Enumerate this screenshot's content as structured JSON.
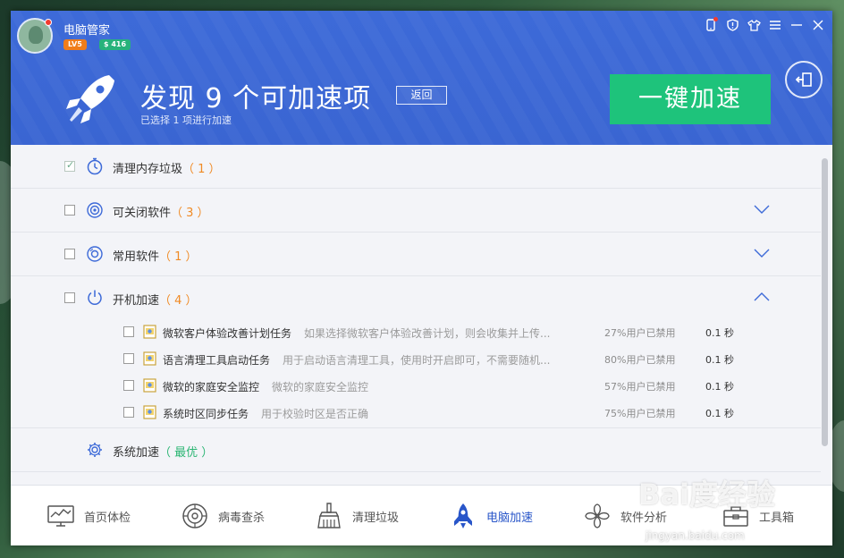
{
  "app": {
    "title": "电脑管家",
    "level": "LV5",
    "coins": "$ 416"
  },
  "header": {
    "headline": "发现 9 个可加速项",
    "back_label": "返回",
    "subline": "已选择 1 项进行加速",
    "accelerate_label": "一键加速"
  },
  "categories": [
    {
      "label": "清理内存垃圾",
      "count": "（ 1 ）",
      "checked": true,
      "icon": "stopwatch-icon"
    },
    {
      "label": "可关闭软件",
      "count": "（ 3 ）",
      "checked": false,
      "icon": "target-icon"
    },
    {
      "label": "常用软件",
      "count": "（ 1 ）",
      "checked": false,
      "icon": "disc-icon"
    },
    {
      "label": "开机加速",
      "count": "（ 4 ）",
      "checked": false,
      "icon": "power-icon"
    },
    {
      "label": "系统加速",
      "count": "（ 最优 ）",
      "icon": "gear-icon"
    }
  ],
  "startup_items": [
    {
      "name": "微软客户体验改善计划任务",
      "desc": "如果选择微软客户体验改善计划，则会收集并上传...",
      "pct": "27%用户已禁用",
      "time": "0.1 秒"
    },
    {
      "name": "语言清理工具启动任务",
      "desc": "用于启动语言清理工具，使用时开启即可，不需要随机...",
      "pct": "80%用户已禁用",
      "time": "0.1 秒"
    },
    {
      "name": "微软的家庭安全监控",
      "desc": "微软的家庭安全监控",
      "pct": "57%用户已禁用",
      "time": "0.1 秒"
    },
    {
      "name": "系统时区同步任务",
      "desc": "用于校验时区是否正确",
      "pct": "75%用户已禁用",
      "time": "0.1 秒"
    }
  ],
  "nav": [
    {
      "label": "首页体检",
      "icon": "monitor-icon"
    },
    {
      "label": "病毒查杀",
      "icon": "shield-scan-icon"
    },
    {
      "label": "清理垃圾",
      "icon": "broom-icon"
    },
    {
      "label": "电脑加速",
      "icon": "rocket-icon",
      "active": true
    },
    {
      "label": "软件分析",
      "icon": "clover-icon"
    },
    {
      "label": "工具箱",
      "icon": "toolbox-icon"
    }
  ],
  "watermark": {
    "text": "Bai度经验",
    "url": "jingyan.baidu.com"
  },
  "colors": {
    "header_blue": "#3d6ad8",
    "accent_green": "#1ec37b",
    "count_orange": "#f08a24",
    "active_nav": "#2956c9"
  }
}
